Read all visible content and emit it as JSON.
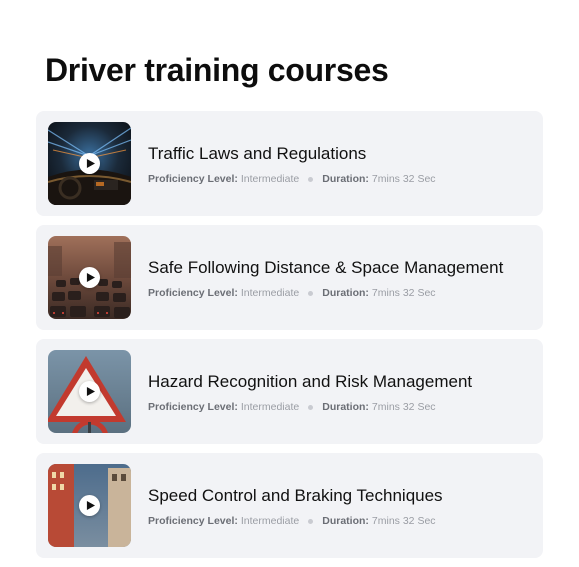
{
  "page": {
    "title": "Driver training courses"
  },
  "courses": [
    {
      "title": "Traffic Laws and Regulations",
      "proficiency_label": "Proficiency Level:",
      "proficiency_value": "Intermediate",
      "duration_label": "Duration:",
      "duration_value": "7mins 32 Sec",
      "thumbnail_icon": "car-interior-image"
    },
    {
      "title": "Safe Following Distance & Space Management",
      "proficiency_label": "Proficiency Level:",
      "proficiency_value": "Intermediate",
      "duration_label": "Duration:",
      "duration_value": "7mins 32 Sec",
      "thumbnail_icon": "traffic-jam-image"
    },
    {
      "title": "Hazard Recognition and Risk Management",
      "proficiency_label": "Proficiency Level:",
      "proficiency_value": "Intermediate",
      "duration_label": "Duration:",
      "duration_value": "7mins 32 Sec",
      "thumbnail_icon": "warning-sign-image"
    },
    {
      "title": "Speed Control and Braking Techniques",
      "proficiency_label": "Proficiency Level:",
      "proficiency_value": "Intermediate",
      "duration_label": "Duration:",
      "duration_value": "7mins 32 Sec",
      "thumbnail_icon": "city-street-image"
    }
  ],
  "colors": {
    "card_background": "#f2f3f6",
    "title_text": "#111111",
    "meta_label": "#6b6e75",
    "meta_value": "#9a9da4"
  }
}
